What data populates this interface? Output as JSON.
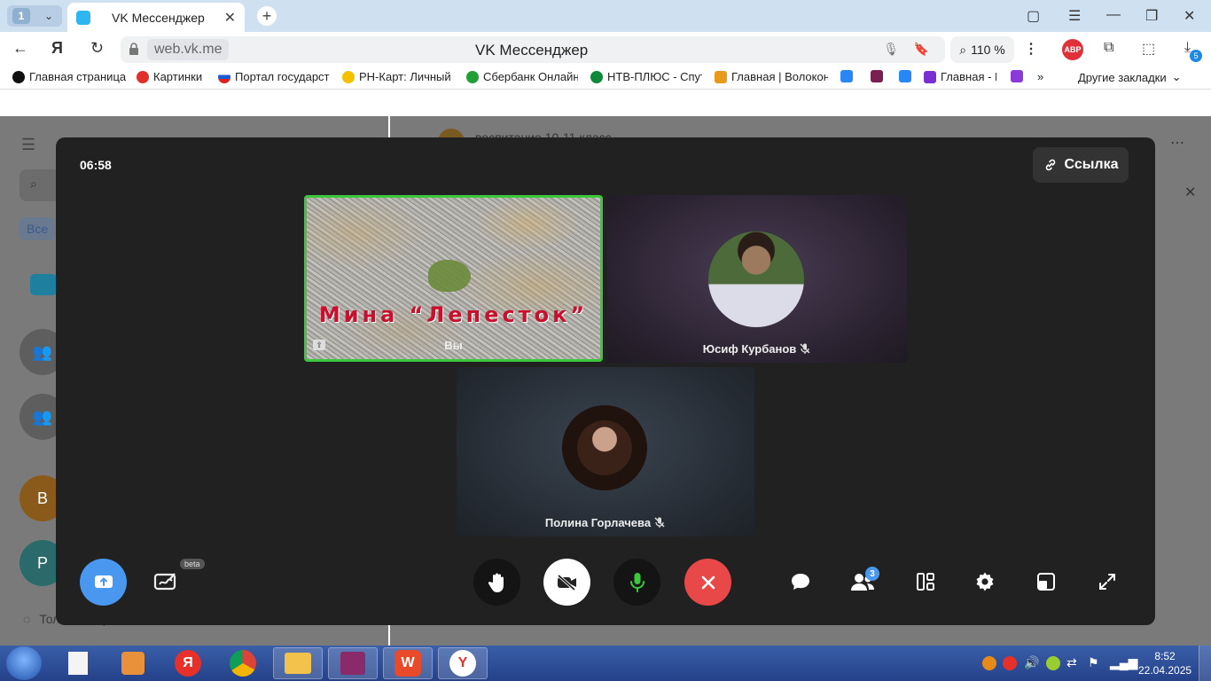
{
  "browser": {
    "tab_count": "1",
    "tab_title": "VK Мессенджер",
    "url": "web.vk.me",
    "page_title": "VK Мессенджер",
    "zoom": "110 %",
    "adblock_label": "ABP",
    "downloads_badge": "5",
    "bookmarks": [
      {
        "label": "Главная страница",
        "color": "#111111"
      },
      {
        "label": "Картинки",
        "color": "#e0302a"
      },
      {
        "label": "Портал государст",
        "color": "#1e5bd0"
      },
      {
        "label": "РН-Карт: Личный",
        "color": "#f2c200"
      },
      {
        "label": "Сбербанк Онлайн",
        "color": "#21a038"
      },
      {
        "label": "НТВ-ПЛЮС - Спут",
        "color": "#0a8a3a"
      },
      {
        "label": "Главная | Волокон",
        "color": "#e89a1a"
      },
      {
        "label": "Главная - E",
        "color": "#7a2fd0"
      }
    ],
    "other_bookmarks": "Другие закладки"
  },
  "call": {
    "timer": "06:58",
    "link_button": "Ссылка",
    "participants": [
      {
        "name": "Вы",
        "video_caption": "Мина “Лепесток”",
        "muted": false
      },
      {
        "name": "Юсиф Курбанов",
        "muted": true
      },
      {
        "name": "Полина Горлачева",
        "muted": true
      }
    ],
    "participants_count": "3",
    "beta_label": "beta"
  },
  "background_page": {
    "chat_title": "воспитание 10-11 класс",
    "filter_all": "Все",
    "avatar_b": "В",
    "avatar_r": "Р",
    "footer_text": "Только непрочитанные"
  },
  "taskbar": {
    "time": "8:52",
    "date": "22.04.2025"
  },
  "colors": {
    "accent_blue": "#4a97f0",
    "end_call_red": "#e84848",
    "speaking_green": "#3cc83c",
    "caption_red": "#c8102e"
  }
}
